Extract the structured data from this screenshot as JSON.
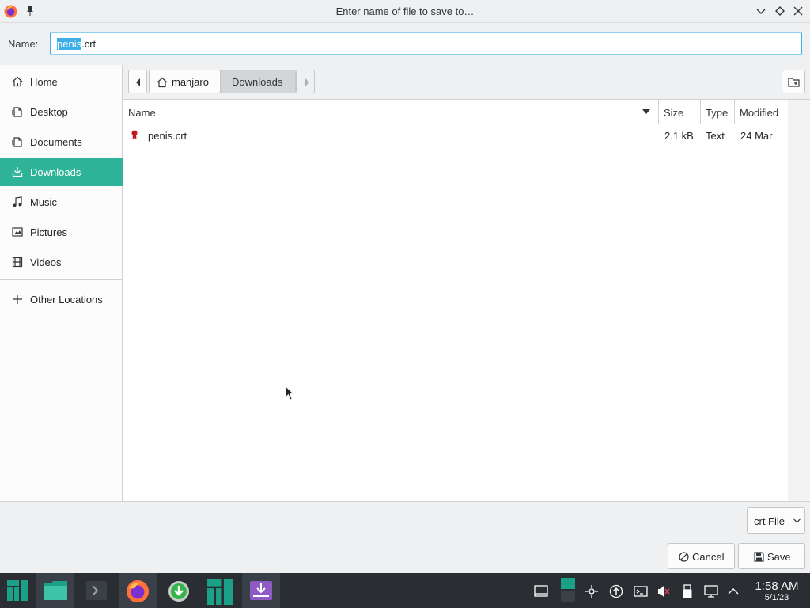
{
  "window": {
    "title": "Enter name of file to save to…"
  },
  "name_row": {
    "label": "Name:",
    "selected_part": "penis",
    "rest_part": ".crt"
  },
  "sidebar": {
    "items": [
      {
        "label": "Home",
        "icon": "home-icon"
      },
      {
        "label": "Desktop",
        "icon": "desktop-icon"
      },
      {
        "label": "Documents",
        "icon": "documents-icon"
      },
      {
        "label": "Downloads",
        "icon": "downloads-icon",
        "active": true
      },
      {
        "label": "Music",
        "icon": "music-icon"
      },
      {
        "label": "Pictures",
        "icon": "pictures-icon"
      },
      {
        "label": "Videos",
        "icon": "videos-icon"
      }
    ],
    "other_locations": "Other Locations"
  },
  "pathbar": {
    "home": "manjaro",
    "current": "Downloads"
  },
  "file_list": {
    "columns": [
      "Name",
      "Size",
      "Type",
      "Modified"
    ],
    "rows": [
      {
        "name": "penis.crt",
        "size": "2.1 kB",
        "type": "Text",
        "modified": "24 Mar"
      }
    ]
  },
  "bottom": {
    "filter": "crt File",
    "cancel": "Cancel",
    "save": "Save"
  },
  "taskbar": {
    "time": "1:58 AM",
    "date": "5/1/23"
  },
  "colors": {
    "accent": "#2eb398",
    "selection": "#3daee9",
    "taskbar": "#2a2e32"
  }
}
